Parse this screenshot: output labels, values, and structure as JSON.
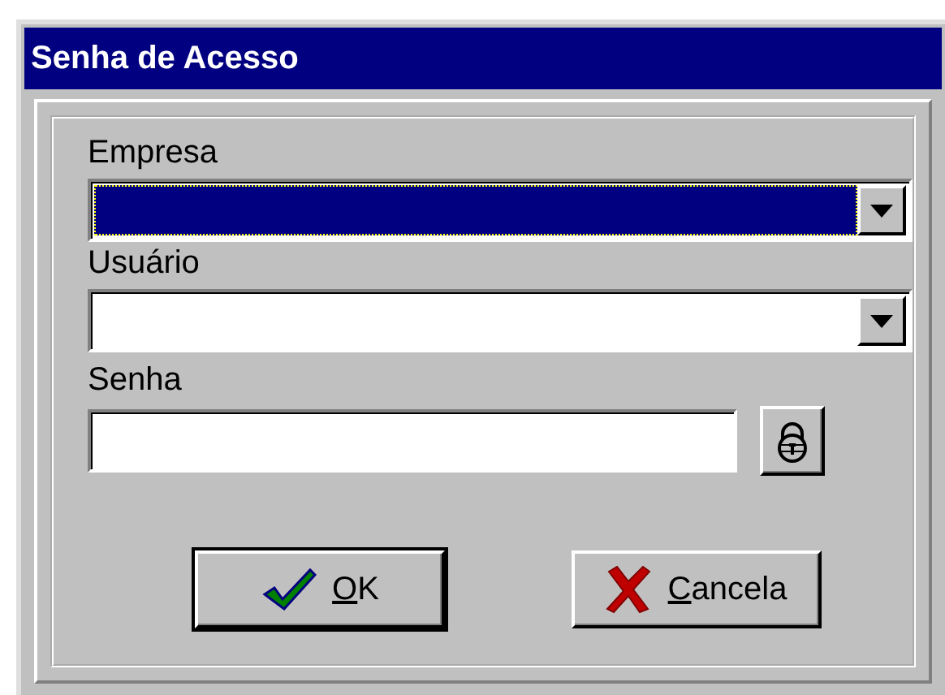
{
  "window": {
    "title": "Senha de Acesso"
  },
  "fields": [
    {
      "kind": "combo",
      "label": "Empresa",
      "focused": true
    },
    {
      "kind": "combo",
      "label": "Usuário",
      "focused": false
    },
    {
      "kind": "password",
      "label": "Senha",
      "focused": false
    }
  ],
  "buttons": [
    {
      "kind": "ok",
      "access_key": "O",
      "label_rest": "K",
      "default": true
    },
    {
      "kind": "cancel",
      "access_key": "C",
      "label_rest": "ancela",
      "default": false
    }
  ]
}
